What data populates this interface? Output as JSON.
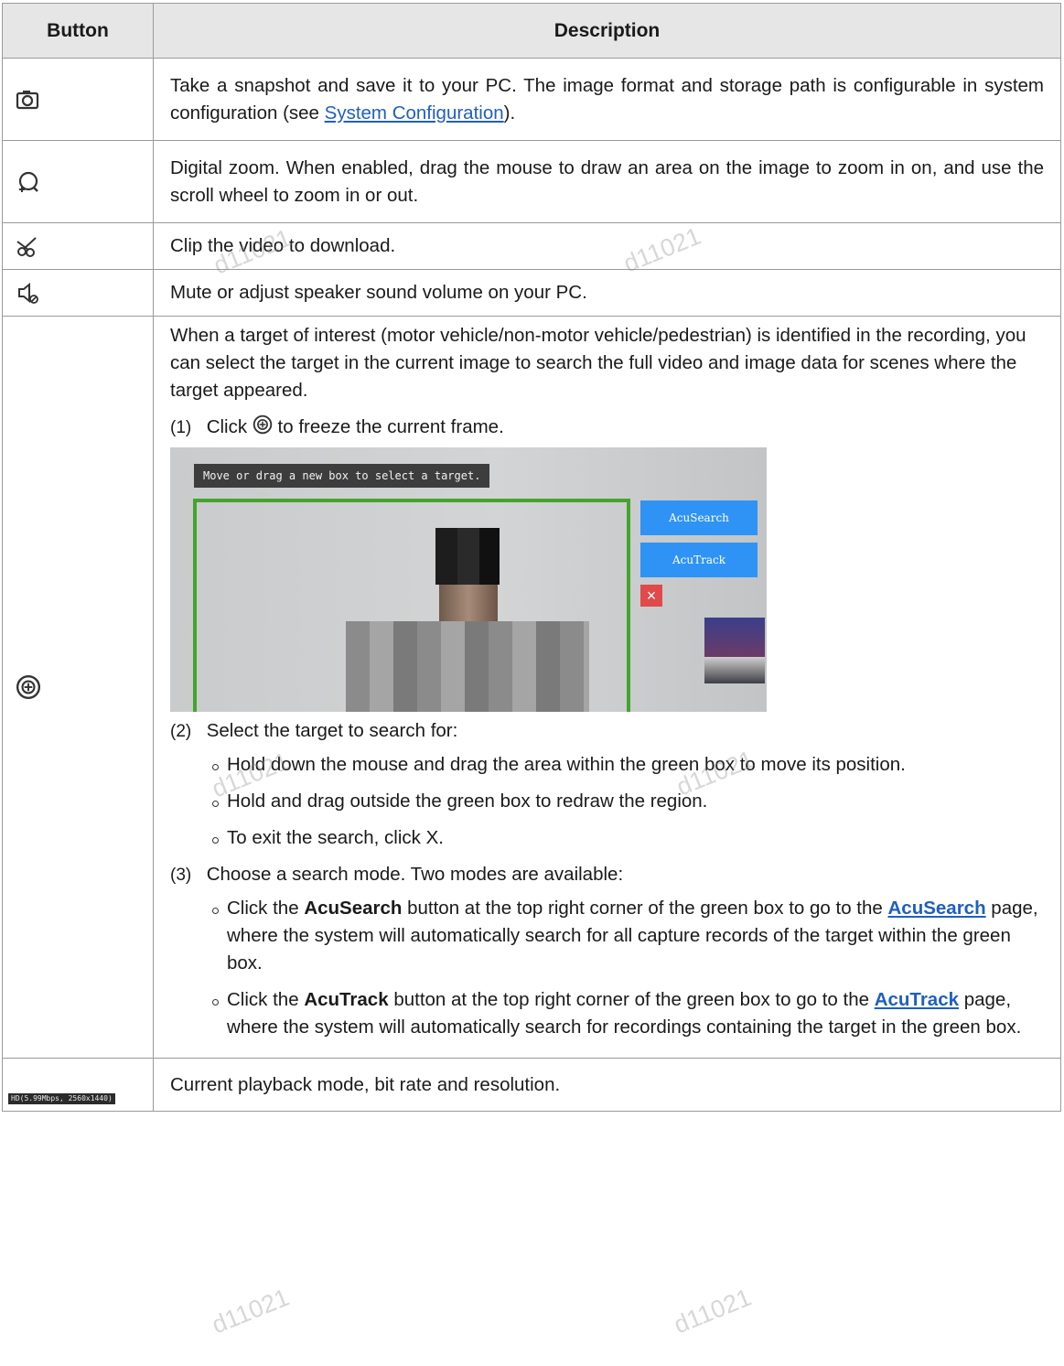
{
  "table": {
    "header_button": "Button",
    "header_description": "Description"
  },
  "rows": {
    "snapshot": {
      "icon": "camera-icon",
      "text_before": "Take a snapshot and save it to your PC. The image format and storage path is configurable in system configuration (see ",
      "link": "System Configuration",
      "text_after": ")."
    },
    "zoom": {
      "icon": "digital-zoom-icon",
      "text": "Digital zoom. When enabled, drag the mouse to draw an area on the image to zoom in on, and use the scroll wheel to zoom in or out."
    },
    "clip": {
      "icon": "scissors-icon",
      "text": "Clip the video to download."
    },
    "mute": {
      "icon": "speaker-mute-icon",
      "text": "Mute or adjust speaker sound volume on your PC."
    },
    "target": {
      "icon": "target-search-icon",
      "intro": "When a target of interest (motor vehicle/non-motor vehicle/pedestrian) is identified in the recording, you can select the target in the current image to search the full video and image data for scenes where the target appeared.",
      "step1_num": "(1)",
      "step1_before": "Click",
      "step1_after": "to freeze the current frame.",
      "screenshot": {
        "tip": "Move or drag a new box to select a target.",
        "btn_search": "AcuSearch",
        "btn_track": "AcuTrack",
        "close": "×"
      },
      "step2_num": "(2)",
      "step2": "Select the target to search for:",
      "step2_bullets": [
        "Hold down the mouse and drag the area within the green box to move its position.",
        "Hold and drag outside the green box to redraw the region.",
        "To exit the search, click X."
      ],
      "step3_num": "(3)",
      "step3": "Choose a search mode. Two modes are available:",
      "step3_b1_pre": "Click the ",
      "step3_b1_bold": "AcuSearch",
      "step3_b1_mid": " button at the top right corner of the green box to go to the ",
      "step3_b1_link": "AcuSearch",
      "step3_b1_post": " page, where the system will automatically search for all capture records of the target within the green box.",
      "step3_b2_pre": "Click the ",
      "step3_b2_bold": "AcuTrack",
      "step3_b2_mid": " button at the top right corner of the green box to go to the ",
      "step3_b2_link": "AcuTrack",
      "step3_b2_post": " page, where the system will automatically search for recordings containing the target in the green box."
    },
    "playback": {
      "badge": "HD(5.99Mbps, 2560x1440)",
      "text": "Current playback mode, bit rate and resolution."
    }
  },
  "watermark": "d11021"
}
